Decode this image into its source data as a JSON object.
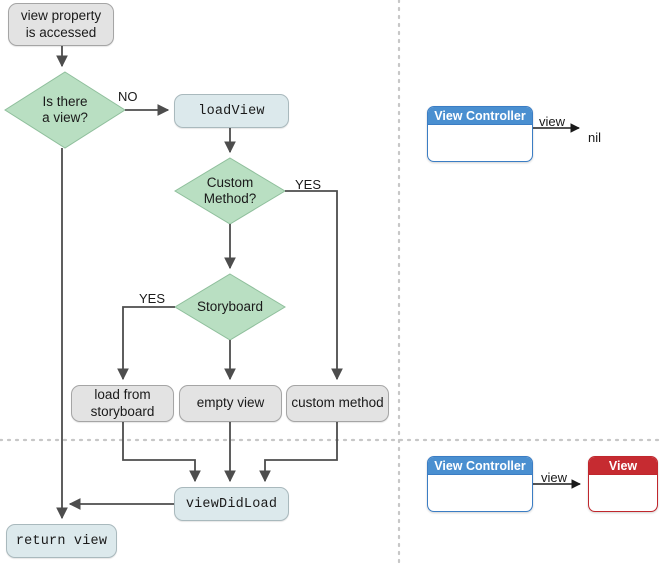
{
  "diagram": {
    "title": "UIViewController view loading flowchart",
    "colors": {
      "process_fill": "#e3e3e3",
      "process_stroke": "#a5a5a5",
      "decision_fill": "#b9dfc2",
      "decision_stroke": "#8fbf9c",
      "code_fill": "#dce9ec",
      "code_stroke": "#a9b9bd",
      "edge_stroke": "#4d4d4d",
      "divider": "#cccccc",
      "blue_accent": "#4a8fd0",
      "red_accent": "#c62b31"
    },
    "nodes": {
      "start": {
        "label_line1": "view property",
        "label_line2": "is accessed"
      },
      "has_view": {
        "label_line1": "Is there",
        "label_line2": "a view?"
      },
      "load_view": {
        "label": "loadView"
      },
      "custom_method_q": {
        "label_line1": "Custom",
        "label_line2": "Method?"
      },
      "storyboard_q": {
        "label": "Storyboard"
      },
      "load_from_storyboard": {
        "label_line1": "load from",
        "label_line2": "storyboard"
      },
      "empty_view": {
        "label": "empty view"
      },
      "custom_method": {
        "label": "custom method"
      },
      "view_did_load": {
        "label": "viewDidLoad"
      },
      "return_view": {
        "label": "return view"
      }
    },
    "edge_labels": {
      "no_has_view": "NO",
      "yes_custom_method": "YES",
      "yes_storyboard": "YES"
    },
    "right_panel": {
      "top": {
        "controller_title": "View Controller",
        "relation_label": "view",
        "target_label": "nil"
      },
      "bottom": {
        "controller_title": "View Controller",
        "relation_label": "view",
        "target_title": "View"
      }
    }
  }
}
